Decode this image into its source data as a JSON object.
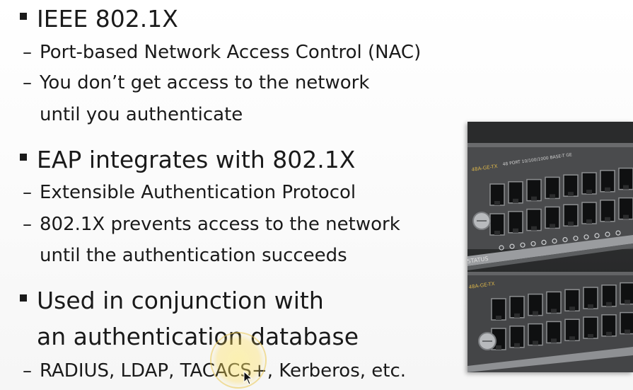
{
  "slide": {
    "sections": [
      {
        "heading": "IEEE 802.1X",
        "points": [
          [
            "Port-based Network Access Control (NAC)"
          ],
          [
            "You don’t get access to the network",
            "until you authenticate"
          ]
        ]
      },
      {
        "heading": "EAP integrates with 802.1X",
        "points": [
          [
            "Extensible Authentication Protocol"
          ],
          [
            "802.1X prevents access to the network",
            "until the authentication succeeds"
          ]
        ]
      },
      {
        "heading": "Used in conjunction with",
        "heading_cont": "an authentication database",
        "points": [
          [
            "RADIUS, LDAP, TACACS+, Kerberos, etc."
          ]
        ]
      }
    ]
  },
  "photo": {
    "icon": "network-switch-photo",
    "labels": {
      "port_label_top": "48 PORT 10/100/1000 BASE-T GE",
      "model_top": "48A-GE-TX",
      "model_bottom": "48A-GE-TX",
      "status": "STATUS"
    }
  },
  "colors": {
    "text": "#1a1a1a",
    "background": "#ffffff",
    "highlight": "#ffe878"
  }
}
